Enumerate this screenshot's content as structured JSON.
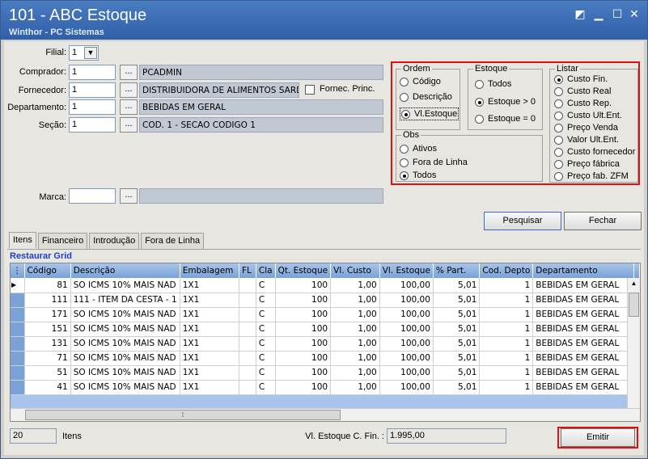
{
  "window": {
    "title": "101 - ABC Estoque",
    "subtitle": "Winthor - PC Sistemas"
  },
  "filters": {
    "filial_label": "Filial:",
    "filial_value": "1",
    "comprador_label": "Comprador:",
    "comprador_code": "1",
    "comprador_name": "PCADMIN",
    "fornecedor_label": "Fornecedor:",
    "fornecedor_code": "1",
    "fornecedor_name": "DISTRIBUIDORA DE ALIMENTOS SARDAO",
    "fornec_princ_label": "Fornec. Princ.",
    "departamento_label": "Departamento:",
    "departamento_code": "1",
    "departamento_name": "BEBIDAS EM GERAL",
    "secao_label": "Seção:",
    "secao_code": "1",
    "secao_name": "COD. 1 - SECAO CODIGO 1",
    "marca_label": "Marca:",
    "marca_code": "",
    "marca_name": "",
    "dots": "..."
  },
  "ordem": {
    "title": "Ordem",
    "options": [
      "Código",
      "Descrição",
      "Vl.Estoque"
    ]
  },
  "estoque": {
    "title": "Estoque",
    "options": [
      "Todos",
      "Estoque > 0",
      "Estoque = 0"
    ]
  },
  "obs": {
    "title": "Obs",
    "options": [
      "Ativos",
      "Fora de Linha",
      "Todos"
    ]
  },
  "listar": {
    "title": "Listar",
    "options": [
      "Custo Fin.",
      "Custo Real",
      "Custo Rep.",
      "Custo Ult.Ent.",
      "Preço Venda",
      "Valor Ult.Ent.",
      "Custo fornecedor",
      "Preço fábrica",
      "Preço fab. ZFM"
    ]
  },
  "buttons": {
    "pesquisar": "Pesquisar",
    "fechar": "Fechar",
    "emitir": "Emitir"
  },
  "tabs": [
    "Itens",
    "Financeiro",
    "Introdução",
    "Fora de Linha"
  ],
  "restaurar": "Restaurar Grid",
  "grid": {
    "columns": [
      "Código",
      "Descrição",
      "Embalagem",
      "FL",
      "Cla",
      "Qt. Estoque",
      "Vl. Custo",
      "Vl. Estoque",
      "% Part.",
      "Cod. Depto",
      "Departamento"
    ],
    "rows": [
      [
        "81",
        "SO ICMS 10% MAIS NAD",
        "1X1",
        "",
        "C",
        "100",
        "1,00",
        "100,00",
        "5,01",
        "1",
        "BEBIDAS EM GERAL"
      ],
      [
        "111",
        "111 - ITEM DA CESTA - 1",
        "1X1",
        "",
        "C",
        "100",
        "1,00",
        "100,00",
        "5,01",
        "1",
        "BEBIDAS EM GERAL"
      ],
      [
        "171",
        "SO ICMS 10% MAIS NAD",
        "1X1",
        "",
        "C",
        "100",
        "1,00",
        "100,00",
        "5,01",
        "1",
        "BEBIDAS EM GERAL"
      ],
      [
        "151",
        "SO ICMS 10% MAIS NAD",
        "1X1",
        "",
        "C",
        "100",
        "1,00",
        "100,00",
        "5,01",
        "1",
        "BEBIDAS EM GERAL"
      ],
      [
        "131",
        "SO ICMS 10% MAIS NAD",
        "1X1",
        "",
        "C",
        "100",
        "1,00",
        "100,00",
        "5,01",
        "1",
        "BEBIDAS EM GERAL"
      ],
      [
        "71",
        "SO ICMS 10% MAIS NAD",
        "1X1",
        "",
        "C",
        "100",
        "1,00",
        "100,00",
        "5,01",
        "1",
        "BEBIDAS EM GERAL"
      ],
      [
        "51",
        "SO ICMS 10% MAIS NAD",
        "1X1",
        "",
        "C",
        "100",
        "1,00",
        "100,00",
        "5,01",
        "1",
        "BEBIDAS EM GERAL"
      ],
      [
        "41",
        "SO ICMS 10% MAIS NAD",
        "1X1",
        "",
        "C",
        "100",
        "1,00",
        "100,00",
        "5,01",
        "1",
        "BEBIDAS EM GERAL"
      ]
    ]
  },
  "footer": {
    "count": "20",
    "itens_label": "Itens",
    "vl_label": "Vl. Estoque C. Fin. :",
    "vl_value": "1.995,00"
  }
}
